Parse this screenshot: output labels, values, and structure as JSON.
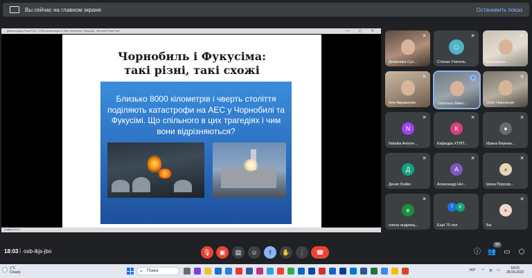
{
  "top_banner": {
    "text": "Вы сейчас на главном экране",
    "stop_label": "Остановить показ"
  },
  "presentation_window": {
    "title": "Демонстрация PowerPoint - [OSB презентация на тему Чорнобиль і Фукусіма] - Microsoft PowerPoint",
    "status": "Слайд 3 из 12",
    "slide": {
      "title_line1": "Чорнобиль і Фукусіма:",
      "title_line2": "такі різні, такі схожі",
      "body": "Близько 8000 кілометрів і чверть століття поділяють катастрофи на АЕС у Чорнобилі та Фукусімі. Що спільного в цих трагедіях і чим вони відрізняються?"
    }
  },
  "participants": [
    {
      "name": "Доминика Сух...",
      "avatar_letter": "",
      "color": ""
    },
    {
      "name": "Степан Учитель",
      "avatar_letter": "",
      "color": ""
    },
    {
      "name": "Екатерина ...",
      "avatar_letter": "",
      "color": ""
    },
    {
      "name": "Аня Авраменко",
      "avatar_letter": "",
      "color": ""
    },
    {
      "name": "Світлана Мико...",
      "avatar_letter": "",
      "color": ""
    },
    {
      "name": "Олег Никольчук",
      "avatar_letter": "",
      "color": ""
    },
    {
      "name": "Nataliia Antone...",
      "avatar_letter": "N",
      "color": "#a142f4"
    },
    {
      "name": "Кафедра ХТЛП...",
      "avatar_letter": "К",
      "color": "#d93f7f"
    },
    {
      "name": "Ирина Бережн...",
      "avatar_letter": "",
      "color": ""
    },
    {
      "name": "Денис Бойко",
      "avatar_letter": "Д",
      "color": "#12a37c"
    },
    {
      "name": "Александр Нег...",
      "avatar_letter": "А",
      "color": "#7e57c2"
    },
    {
      "name": "Ірина Порсюр...",
      "avatar_letter": "",
      "color": ""
    },
    {
      "name": "олена андрющ...",
      "avatar_letter": "е",
      "color": "#1e8e3e"
    },
    {
      "name": "Ещё 75 чел.",
      "avatar_letter": "",
      "color": ""
    },
    {
      "name": "Вы",
      "avatar_letter": "",
      "color": ""
    }
  ],
  "more_avatars": [
    "Т",
    "К"
  ],
  "meeting": {
    "time": "18:03",
    "separator": "|",
    "code": "osb-ikjs-jbo",
    "participant_badge": "90"
  },
  "taskbar": {
    "temperature": "1°C",
    "weather": "Cloudy",
    "search_placeholder": "Поиск",
    "language": "УКР",
    "clock_time": "18:03",
    "clock_date": "28.04.2023"
  },
  "colors": {
    "accent": "#8ab4f8",
    "danger": "#ea4335",
    "slide_blue": "#2e73c4"
  }
}
